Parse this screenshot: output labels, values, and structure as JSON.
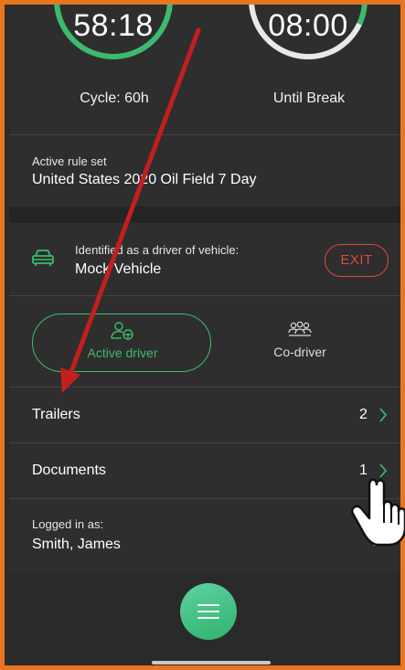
{
  "timers": {
    "cycle": {
      "value": "58:18",
      "label": "Cycle: 60h"
    },
    "break": {
      "value": "08:00",
      "label": "Until Break"
    }
  },
  "rule_set": {
    "label": "Active rule set",
    "value": "United States 2020 Oil Field 7 Day"
  },
  "vehicle": {
    "label": "Identified as a driver of vehicle:",
    "name": "Mock Vehicle",
    "exit_label": "EXIT"
  },
  "roles": {
    "active": {
      "label": "Active driver",
      "selected": true
    },
    "co": {
      "label": "Co-driver",
      "selected": false
    }
  },
  "rows": {
    "trailers": {
      "label": "Trailers",
      "count": "2"
    },
    "documents": {
      "label": "Documents",
      "count": "1"
    }
  },
  "logged_in": {
    "label": "Logged in as:",
    "name": "Smith, James"
  },
  "icons": {
    "vehicle": "car-icon",
    "active_driver": "driver-steering-icon",
    "co_driver": "people-group-icon",
    "chevron": "chevron-right-icon",
    "menu": "hamburger-menu-icon",
    "logout": "logout-icon",
    "annotation_arrow": "red-arrow",
    "cursor": "hand-pointer-icon"
  },
  "colors": {
    "accent_green": "#3dbb6d",
    "danger_red": "#e2473d",
    "background": "#2e2e2e",
    "frame_border": "#e8751f",
    "annotation_arrow": "#c21f1f"
  }
}
